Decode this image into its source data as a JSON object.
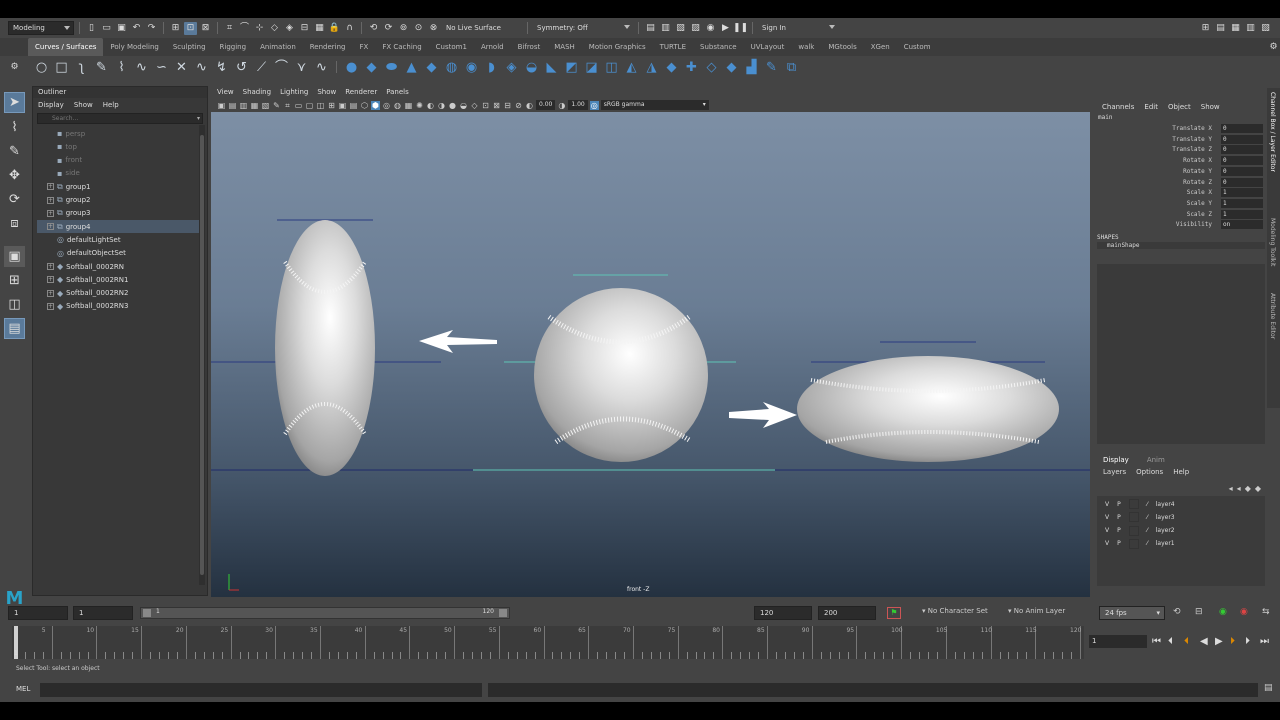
{
  "status_line": {
    "workspace": "Modeling",
    "live_surface": "No Live Surface",
    "symmetry": "Symmetry: Off",
    "sign_in": "Sign In"
  },
  "shelf_tabs": [
    "Curves / Surfaces",
    "Poly Modeling",
    "Sculpting",
    "Rigging",
    "Animation",
    "Rendering",
    "FX",
    "FX Caching",
    "Custom1",
    "Arnold",
    "Bifrost",
    "MASH",
    "Motion Graphics",
    "TURTLE",
    "Substance",
    "UVLayout",
    "walk",
    "MGtools",
    "XGen",
    "Custom"
  ],
  "outliner": {
    "title": "Outliner",
    "menu": [
      "Display",
      "Show",
      "Help"
    ],
    "search_placeholder": "Search...",
    "items": [
      {
        "label": "persp",
        "style": "dim",
        "expand": false,
        "icon": "camera-icon"
      },
      {
        "label": "top",
        "style": "dim",
        "expand": false,
        "icon": "camera-icon"
      },
      {
        "label": "front",
        "style": "dim",
        "expand": false,
        "icon": "camera-icon"
      },
      {
        "label": "side",
        "style": "dim",
        "expand": false,
        "icon": "camera-icon"
      },
      {
        "label": "group1",
        "style": "normal",
        "expand": true,
        "icon": "group-icon"
      },
      {
        "label": "group2",
        "style": "normal",
        "expand": true,
        "icon": "group-icon"
      },
      {
        "label": "group3",
        "style": "normal",
        "expand": true,
        "icon": "group-icon"
      },
      {
        "label": "group4",
        "style": "selected",
        "expand": true,
        "icon": "group-icon"
      },
      {
        "label": "defaultLightSet",
        "style": "normal",
        "expand": false,
        "icon": "set-icon"
      },
      {
        "label": "defaultObjectSet",
        "style": "normal",
        "expand": false,
        "icon": "set-icon"
      },
      {
        "label": "Softball_0002RN",
        "style": "normal",
        "expand": true,
        "icon": "reference-icon"
      },
      {
        "label": "Softball_0002RN1",
        "style": "normal",
        "expand": true,
        "icon": "reference-icon"
      },
      {
        "label": "Softball_0002RN2",
        "style": "normal",
        "expand": true,
        "icon": "reference-icon"
      },
      {
        "label": "Softball_0002RN3",
        "style": "normal",
        "expand": true,
        "icon": "reference-icon"
      }
    ]
  },
  "viewport": {
    "menu": [
      "View",
      "Shading",
      "Lighting",
      "Show",
      "Renderer",
      "Panels"
    ],
    "exposure": "0.00",
    "gamma": "1.00",
    "color_space": "sRGB gamma",
    "camera_label": "front -Z"
  },
  "channel_box": {
    "menu": [
      "Channels",
      "Edit",
      "Object",
      "Show"
    ],
    "object_name": "main",
    "attributes": [
      {
        "name": "Translate X",
        "value": "0"
      },
      {
        "name": "Translate Y",
        "value": "0"
      },
      {
        "name": "Translate Z",
        "value": "0"
      },
      {
        "name": "Rotate X",
        "value": "0"
      },
      {
        "name": "Rotate Y",
        "value": "0"
      },
      {
        "name": "Rotate Z",
        "value": "0"
      },
      {
        "name": "Scale X",
        "value": "1"
      },
      {
        "name": "Scale Y",
        "value": "1"
      },
      {
        "name": "Scale Z",
        "value": "1"
      },
      {
        "name": "Visibility",
        "value": "on"
      }
    ],
    "shapes_header": "SHAPES",
    "shape_name": "mainShape",
    "side_tabs": [
      "Channel Box / Layer Editor",
      "Modeling Toolkit",
      "Attribute Editor"
    ]
  },
  "layer_editor": {
    "tabs": [
      "Display",
      "Anim"
    ],
    "menu": [
      "Layers",
      "Options",
      "Help"
    ],
    "layers": [
      {
        "v": "V",
        "p": "P",
        "name": "layer4"
      },
      {
        "v": "V",
        "p": "P",
        "name": "layer3"
      },
      {
        "v": "V",
        "p": "P",
        "name": "layer2"
      },
      {
        "v": "V",
        "p": "P",
        "name": "layer1"
      }
    ]
  },
  "range_slider": {
    "start": "1",
    "anim_start": "1",
    "slider_start": "1",
    "slider_end": "120",
    "end": "120",
    "anim_end": "200",
    "character_set": "No Character Set",
    "anim_layer": "No Anim Layer",
    "fps": "24 fps"
  },
  "timeline": {
    "ticks": [
      "5",
      "10",
      "15",
      "20",
      "25",
      "30",
      "35",
      "40",
      "45",
      "50",
      "55",
      "60",
      "65",
      "70",
      "75",
      "80",
      "85",
      "90",
      "95",
      "100",
      "105",
      "110",
      "115",
      "120"
    ],
    "current_frame_label": "1",
    "current_frame": "1"
  },
  "help_line": "Select Tool: select an object",
  "command_line": {
    "label": "MEL"
  }
}
